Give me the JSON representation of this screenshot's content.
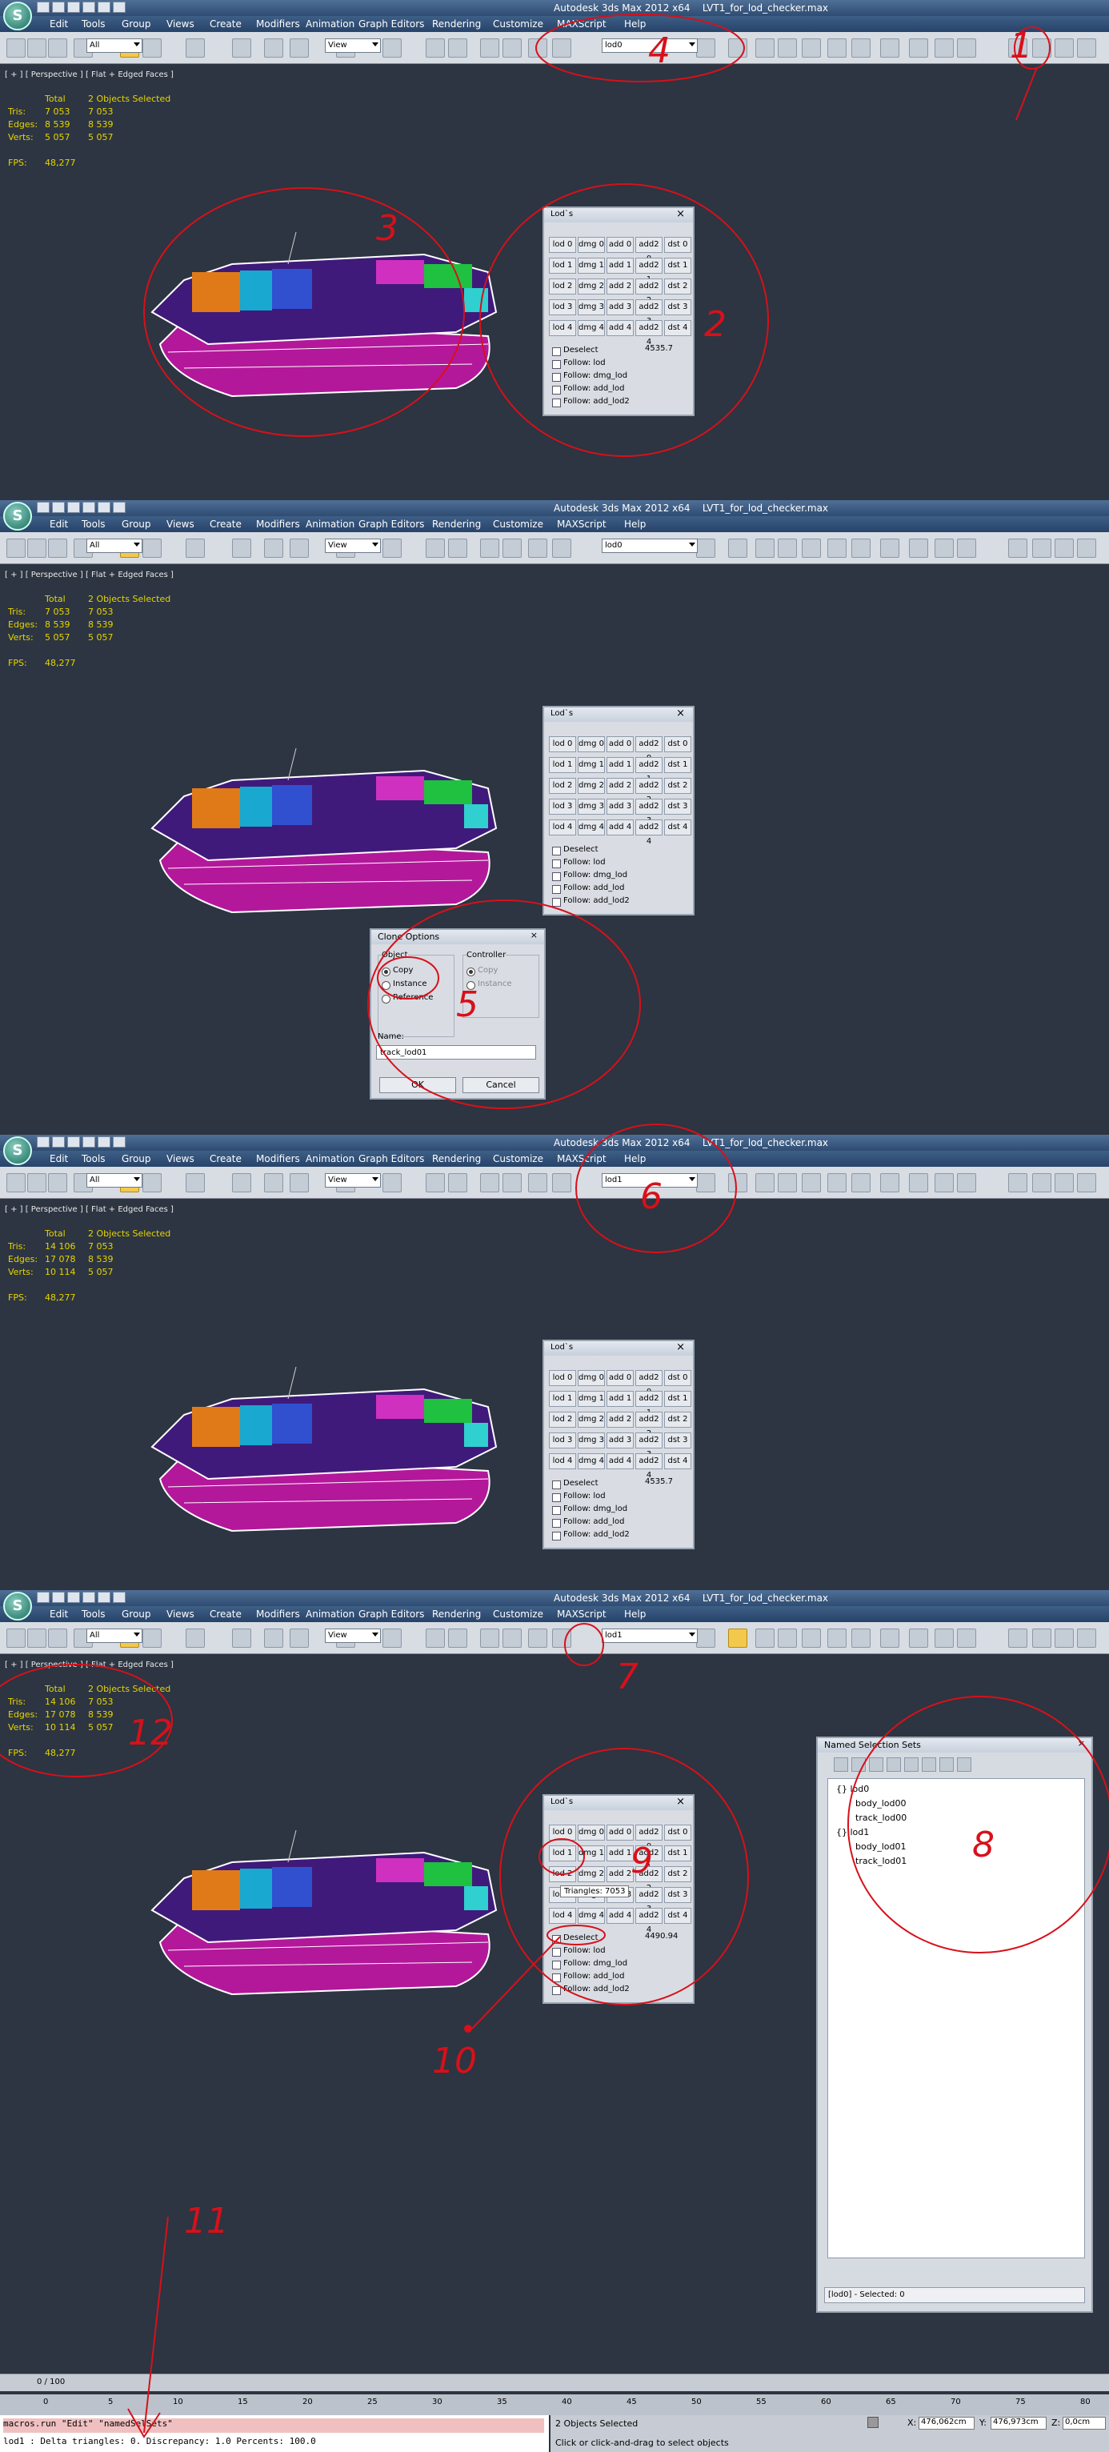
{
  "window": {
    "title": "Autodesk 3ds Max  2012 x64",
    "file": "LVT1_for_lod_checker.max"
  },
  "menu": [
    "Edit",
    "Tools",
    "Group",
    "Views",
    "Create",
    "Modifiers",
    "Animation",
    "Graph Editors",
    "Rendering",
    "Customize",
    "MAXScript",
    "Help"
  ],
  "toolbar": {
    "filter": "All",
    "view": "View",
    "named_sets": [
      "lod0",
      "lod0",
      "lod1",
      "lod1"
    ]
  },
  "viewport": {
    "label": "[ + ] [ Perspective ] [ Flat + Edged Faces ]",
    "stats_header": [
      "Total",
      "2 Objects Selected"
    ],
    "panels": [
      {
        "tris": [
          "7 053",
          "7 053"
        ],
        "edges": [
          "8 539",
          "8 539"
        ],
        "verts": [
          "5 057",
          "5 057"
        ],
        "fps": "48,277"
      },
      {
        "tris": [
          "7 053",
          "7 053"
        ],
        "edges": [
          "8 539",
          "8 539"
        ],
        "verts": [
          "5 057",
          "5 057"
        ],
        "fps": "48,277"
      },
      {
        "tris": [
          "14 106",
          "7 053"
        ],
        "edges": [
          "17 078",
          "8 539"
        ],
        "verts": [
          "10 114",
          "5 057"
        ],
        "fps": "48,277"
      },
      {
        "tris": [
          "14 106",
          "7 053"
        ],
        "edges": [
          "17 078",
          "8 539"
        ],
        "verts": [
          "10 114",
          "5 057"
        ],
        "fps": "48,277"
      }
    ],
    "row_labels": [
      "Tris:",
      "Edges:",
      "Verts:",
      "FPS:"
    ]
  },
  "lods_dialog": {
    "title": "Lod`s",
    "grid": [
      [
        "lod 0",
        "dmg 0",
        "add 0",
        "add2 0",
        "dst 0"
      ],
      [
        "lod 1",
        "dmg 1",
        "add 1",
        "add2 1",
        "dst 1"
      ],
      [
        "lod 2",
        "dmg 2",
        "add 2",
        "add2 2",
        "dst 2"
      ],
      [
        "lod 3",
        "dmg 3",
        "add 3",
        "add2 3",
        "dst 3"
      ],
      [
        "lod 4",
        "dmg 4",
        "add 4",
        "add2 4",
        "dst 4"
      ]
    ],
    "checks": [
      "Deselect",
      "Follow: lod",
      "Follow: dmg_lod",
      "Follow: add_lod",
      "Follow: add_lod2"
    ],
    "values": [
      "4535.7",
      "",
      "4535.7",
      "4490.94"
    ],
    "tooltip": "Triangles: 7053"
  },
  "clone_options": {
    "title": "Clone Options",
    "object_group": "Object",
    "controller_group": "Controller",
    "object_options": [
      "Copy",
      "Instance",
      "Reference"
    ],
    "controller_options": [
      "Copy",
      "Instance"
    ],
    "name_label": "Name:",
    "name_value": "track_lod01",
    "ok": "OK",
    "cancel": "Cancel"
  },
  "named_selection_sets": {
    "title": "Named Selection Sets",
    "tree": [
      "{} lod0",
      "body_lod00",
      "track_lod00",
      "{} lod1",
      "body_lod01",
      "track_lod01"
    ],
    "footer": "[lod0] - Selected: 0"
  },
  "timeline": {
    "frame": "0 / 100"
  },
  "ruler": [
    "0",
    "5",
    "10",
    "15",
    "20",
    "25",
    "30",
    "35",
    "40",
    "45",
    "50",
    "55",
    "60",
    "65",
    "70",
    "75",
    "80"
  ],
  "maxscript": {
    "line1": "macros.run \"Edit\" \"namedSelSets\"",
    "line2": "lod1 : Delta triangles: 0. Discrepancy: 1.0 Percents: 100.0"
  },
  "status": {
    "selected": "2 Objects Selected",
    "hint": "Click or click-and-drag to select objects",
    "x": "476,062cm",
    "y": "476,973cm",
    "z": "0,0cm"
  },
  "annotations": [
    "1",
    "2",
    "3",
    "4",
    "5",
    "6",
    "7",
    "8",
    "9",
    "10",
    "11",
    "12"
  ]
}
